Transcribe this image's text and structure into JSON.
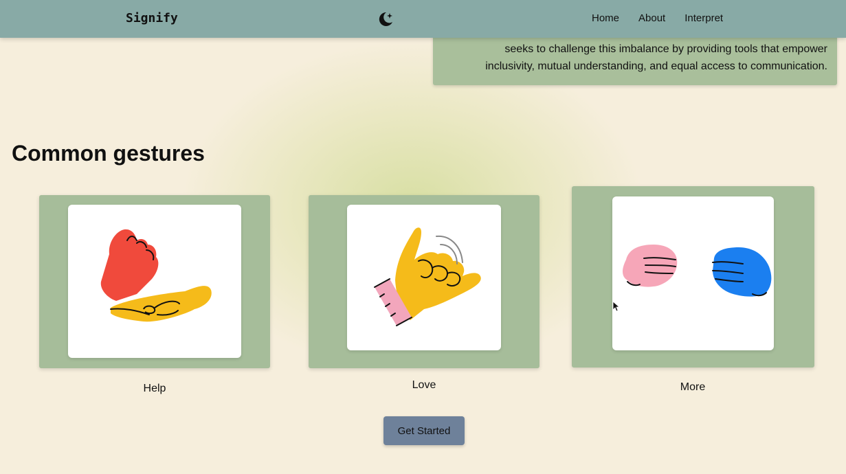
{
  "nav": {
    "brand": "Signify",
    "theme_toggle_icon": "moon-star-icon",
    "links": [
      {
        "label": "Home"
      },
      {
        "label": "About"
      },
      {
        "label": "Interpret"
      }
    ]
  },
  "about": {
    "line1": "seeks to challenge this imbalance by providing tools that empower",
    "line2": "inclusivity, mutual understanding, and equal access to communication."
  },
  "gestures": {
    "title": "Common gestures",
    "items": [
      {
        "label": "Help",
        "icon": "help-gesture-illustration"
      },
      {
        "label": "Love",
        "icon": "love-gesture-illustration"
      },
      {
        "label": "More",
        "icon": "more-gesture-illustration"
      }
    ]
  },
  "cta": {
    "label": "Get Started"
  },
  "colors": {
    "navbar": "#88aaa6",
    "card": "#a6bd9a",
    "button": "#6e819a",
    "background": "#f6eedc"
  }
}
